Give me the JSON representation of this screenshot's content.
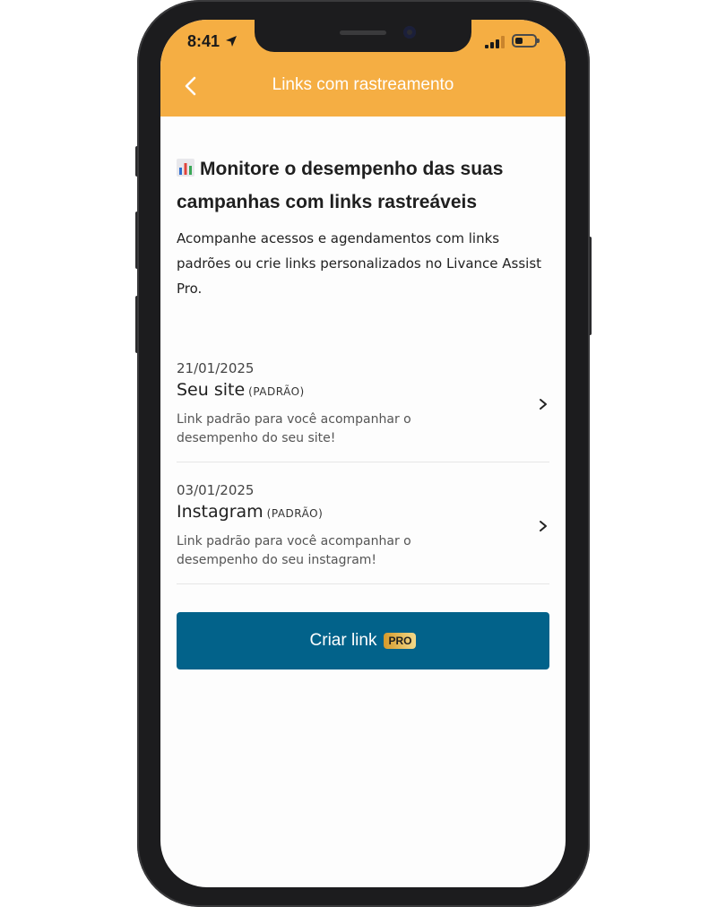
{
  "status_bar": {
    "time": "8:41"
  },
  "header": {
    "title": "Links com rastreamento",
    "color": "#f5ae43"
  },
  "intro": {
    "title": "Monitore o desempenho das suas campanhas com links rastreáveis",
    "description": "Acompanhe acessos e agendamentos com links padrões ou crie links personalizados no Livance Assist Pro."
  },
  "links": [
    {
      "date": "21/01/2025",
      "title": "Seu site",
      "tag": "(PADRÃO)",
      "description": "Link padrão para você acompanhar o desempenho do seu site!"
    },
    {
      "date": "03/01/2025",
      "title": "Instagram",
      "tag": "(PADRÃO)",
      "description": "Link padrão para você acompanhar o desempenho do seu instagram!"
    }
  ],
  "create_button": {
    "label": "Criar link",
    "badge": "PRO",
    "color": "#02628a"
  }
}
